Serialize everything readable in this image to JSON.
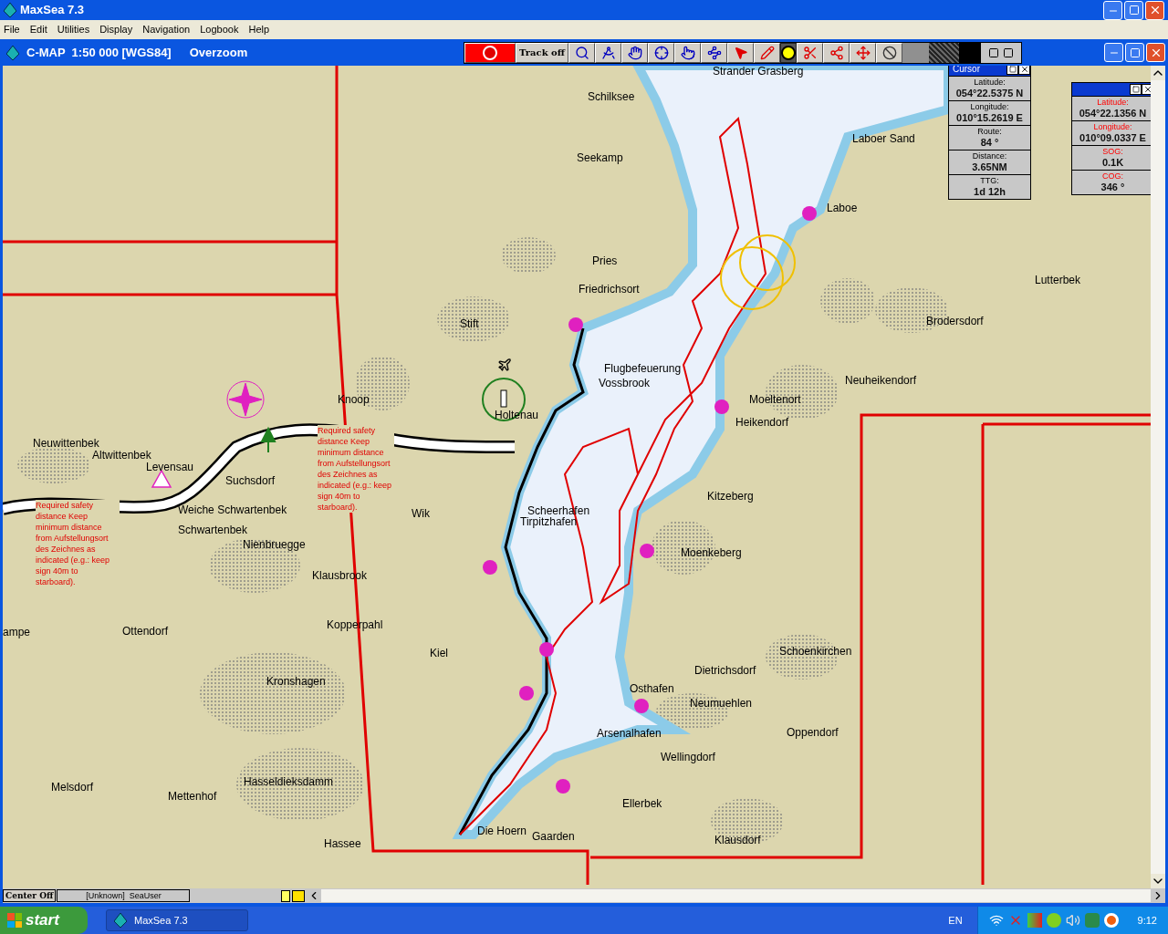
{
  "window": {
    "title": "MaxSea 7.3"
  },
  "menu": [
    "File",
    "Edit",
    "Utilities",
    "Display",
    "Navigation",
    "Logbook",
    "Help"
  ],
  "chart_window": {
    "title": "C-MAP  1:50 000 [WGS84]",
    "mode": "Overzoom"
  },
  "toolbar": [
    {
      "kind": "record",
      "selected": false
    },
    {
      "kind": "track",
      "label": "Track off",
      "selected": false
    },
    {
      "kind": "zoom",
      "selected": false
    },
    {
      "kind": "divider",
      "selected": false
    },
    {
      "kind": "hand",
      "selected": false
    },
    {
      "kind": "crosshair",
      "selected": false
    },
    {
      "kind": "pointer",
      "selected": false
    },
    {
      "kind": "route",
      "selected": false
    },
    {
      "kind": "arrow",
      "selected": false
    },
    {
      "kind": "pencil",
      "selected": false
    },
    {
      "kind": "target",
      "selected": true
    },
    {
      "kind": "scissors",
      "selected": false
    },
    {
      "kind": "network",
      "selected": false
    },
    {
      "kind": "move",
      "selected": false
    },
    {
      "kind": "stop",
      "selected": false
    }
  ],
  "places": [
    "Strander Grasberg",
    "Schilksee",
    "Seekamp",
    "Laboer Sand",
    "Laboe",
    "Pries",
    "Friedrichsort",
    "Lutterbek",
    "Stift",
    "Brodersdorf",
    "Flugbefeuerung",
    "Vossbrook",
    "Neuheikendorf",
    "Knoop",
    "Moeltenort",
    "Holtenau",
    "Heikendorf",
    "Neuwittenbek",
    "Altwittenbek",
    "Levensau",
    "Suchsdorf",
    "Kitzeberg",
    "Weiche Schwartenbek",
    "Wik",
    "Scheerhafen",
    "Tirpitzhafen",
    "Schwartenbek",
    "Nienbruegge",
    "Moenkeberg",
    "Klausbrook",
    "Kopperpahl",
    "ampe",
    "Ottendorf",
    "Kiel",
    "Schoenkirchen",
    "Dietrichsdorf",
    "Kronshagen",
    "Osthafen",
    "Neumuehlen",
    "Arsenalhafen",
    "Oppendorf",
    "Wellingdorf",
    "Hasseldieksdamm",
    "Melsdorf",
    "Mettenhof",
    "Ellerbek",
    "Die Hoern",
    "Gaarden",
    "Klausdorf",
    "Hassee"
  ],
  "notes": [
    "Required safety distance Keep minimum distance from Aufstellungsort des Zeichnes as indicated (e.g.: keep sign 40m to starboard).",
    "Required safety distance Keep minimum distance from Aufstellungsort des Zeichnes as indicated (e.g.: keep sign 40m to starboard)."
  ],
  "panels": [
    {
      "title": "Cursor",
      "alarm": false,
      "fields": [
        {
          "label": "Latitude:",
          "value": "054°22.5375 N"
        },
        {
          "label": "Longitude:",
          "value": "010°15.2619 E"
        },
        {
          "label": "Route:",
          "value": "84 °"
        },
        {
          "label": "Distance:",
          "value": "3.65NM"
        },
        {
          "label": "TTG:",
          "value": "1d 12h"
        }
      ]
    },
    {
      "alarm": true,
      "fields": [
        {
          "label": "Latitude:",
          "value": "054°22.1356 N"
        },
        {
          "label": "Longitude:",
          "value": "010°09.0337 E"
        },
        {
          "label": "SOG:",
          "value": "0.1K"
        },
        {
          "label": "COG:",
          "value": "346 °"
        }
      ]
    }
  ],
  "status_bar": {
    "center_button": "Center Off",
    "user": "[Unknown]  SeaUser"
  },
  "taskbar": {
    "start": "start",
    "task": "MaxSea 7.3",
    "language": "EN",
    "clock": "9:12"
  }
}
